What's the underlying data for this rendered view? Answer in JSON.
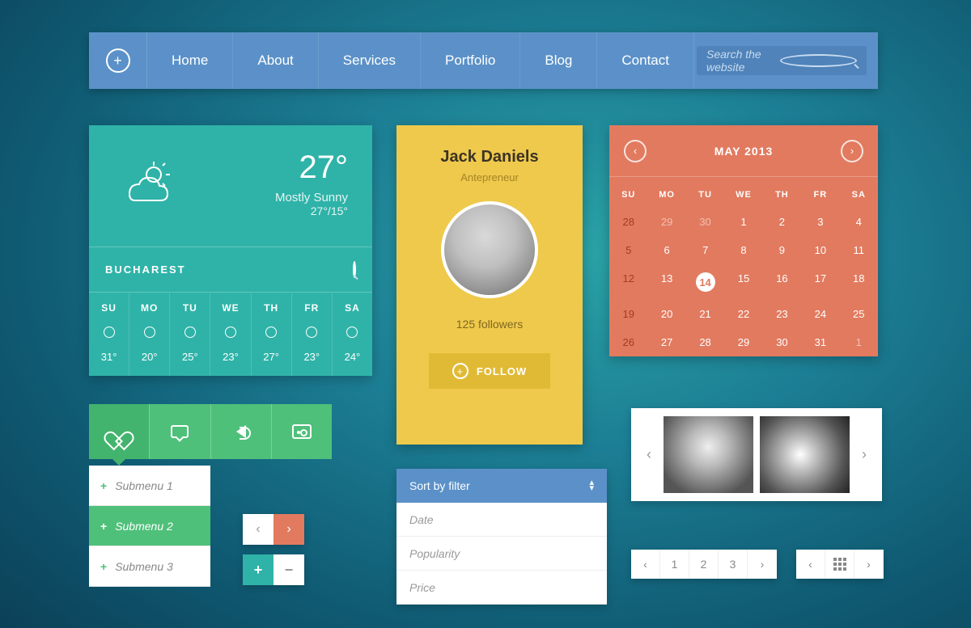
{
  "nav": {
    "items": [
      "Home",
      "About",
      "Services",
      "Portfolio",
      "Blog",
      "Contact"
    ],
    "search_placeholder": "Search the website"
  },
  "weather": {
    "temp": "27°",
    "condition": "Mostly Sunny",
    "hilo": "27°/15°",
    "city": "BUCHAREST",
    "days": [
      {
        "d": "SU",
        "t": "31°"
      },
      {
        "d": "MO",
        "t": "20°"
      },
      {
        "d": "TU",
        "t": "25°"
      },
      {
        "d": "WE",
        "t": "23°"
      },
      {
        "d": "TH",
        "t": "27°"
      },
      {
        "d": "FR",
        "t": "23°"
      },
      {
        "d": "SA",
        "t": "24°"
      }
    ]
  },
  "profile": {
    "name": "Jack Daniels",
    "role": "Antepreneur",
    "followers": "125 followers",
    "follow_label": "FOLLOW"
  },
  "calendar": {
    "title": "MAY 2013",
    "dow": [
      "SU",
      "MO",
      "TU",
      "WE",
      "TH",
      "FR",
      "SA"
    ],
    "cells": [
      {
        "n": "28",
        "c": "out sun"
      },
      {
        "n": "29",
        "c": "out"
      },
      {
        "n": "30",
        "c": "out"
      },
      {
        "n": "1",
        "c": ""
      },
      {
        "n": "2",
        "c": ""
      },
      {
        "n": "3",
        "c": ""
      },
      {
        "n": "4",
        "c": ""
      },
      {
        "n": "5",
        "c": "sun"
      },
      {
        "n": "6",
        "c": ""
      },
      {
        "n": "7",
        "c": ""
      },
      {
        "n": "8",
        "c": ""
      },
      {
        "n": "9",
        "c": ""
      },
      {
        "n": "10",
        "c": ""
      },
      {
        "n": "11",
        "c": ""
      },
      {
        "n": "12",
        "c": "sun"
      },
      {
        "n": "13",
        "c": ""
      },
      {
        "n": "14",
        "c": "today"
      },
      {
        "n": "15",
        "c": ""
      },
      {
        "n": "16",
        "c": ""
      },
      {
        "n": "17",
        "c": ""
      },
      {
        "n": "18",
        "c": ""
      },
      {
        "n": "19",
        "c": "sun"
      },
      {
        "n": "20",
        "c": ""
      },
      {
        "n": "21",
        "c": ""
      },
      {
        "n": "22",
        "c": ""
      },
      {
        "n": "23",
        "c": ""
      },
      {
        "n": "24",
        "c": ""
      },
      {
        "n": "25",
        "c": ""
      },
      {
        "n": "26",
        "c": "sun"
      },
      {
        "n": "27",
        "c": ""
      },
      {
        "n": "28",
        "c": ""
      },
      {
        "n": "29",
        "c": ""
      },
      {
        "n": "30",
        "c": ""
      },
      {
        "n": "31",
        "c": ""
      },
      {
        "n": "1",
        "c": "out"
      }
    ]
  },
  "submenu": {
    "items": [
      {
        "label": "Submenu 1",
        "active": false
      },
      {
        "label": "Submenu 2",
        "active": true
      },
      {
        "label": "Submenu 3",
        "active": false
      }
    ]
  },
  "sort": {
    "title": "Sort by filter",
    "options": [
      "Date",
      "Popularity",
      "Price"
    ]
  },
  "pager": {
    "pages": [
      "1",
      "2",
      "3"
    ]
  },
  "symbols": {
    "left": "‹",
    "right": "›",
    "plus": "+",
    "minus": "−",
    "up": "▴",
    "down": "▾"
  }
}
